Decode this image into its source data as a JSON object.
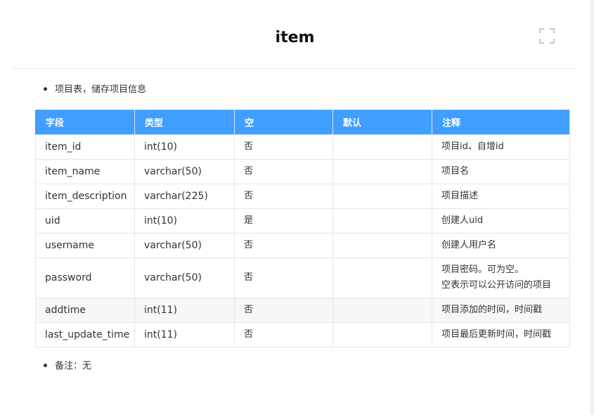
{
  "title": "item",
  "intro": "项目表，储存项目信息",
  "columns": [
    "字段",
    "类型",
    "空",
    "默认",
    "注释"
  ],
  "rows": [
    {
      "field": "item_id",
      "type": "int(10)",
      "null": "否",
      "default": "",
      "comment": "项目id、自增id"
    },
    {
      "field": "item_name",
      "type": "varchar(50)",
      "null": "否",
      "default": "",
      "comment": "项目名"
    },
    {
      "field": "item_description",
      "type": "varchar(225)",
      "null": "否",
      "default": "",
      "comment": "项目描述"
    },
    {
      "field": "uid",
      "type": "int(10)",
      "null": "是",
      "default": "",
      "comment": "创建人uid"
    },
    {
      "field": "username",
      "type": "varchar(50)",
      "null": "否",
      "default": "",
      "comment": "创建人用户名"
    },
    {
      "field": "password",
      "type": "varchar(50)",
      "null": "否",
      "default": "",
      "comment": "项目密码。可为空。",
      "comment2": "空表示可以公开访问的项目"
    },
    {
      "field": "addtime",
      "type": "int(11)",
      "null": "否",
      "default": "",
      "comment": "项目添加的时间，时间戳"
    },
    {
      "field": "last_update_time",
      "type": "int(11)",
      "null": "否",
      "default": "",
      "comment": "项目最后更新时间，时间戳"
    }
  ],
  "note": "备注：无",
  "icons": {
    "fullscreen": "fullscreen-icon"
  },
  "colors": {
    "header_bg": "#409eff",
    "header_text": "#ffffff"
  }
}
